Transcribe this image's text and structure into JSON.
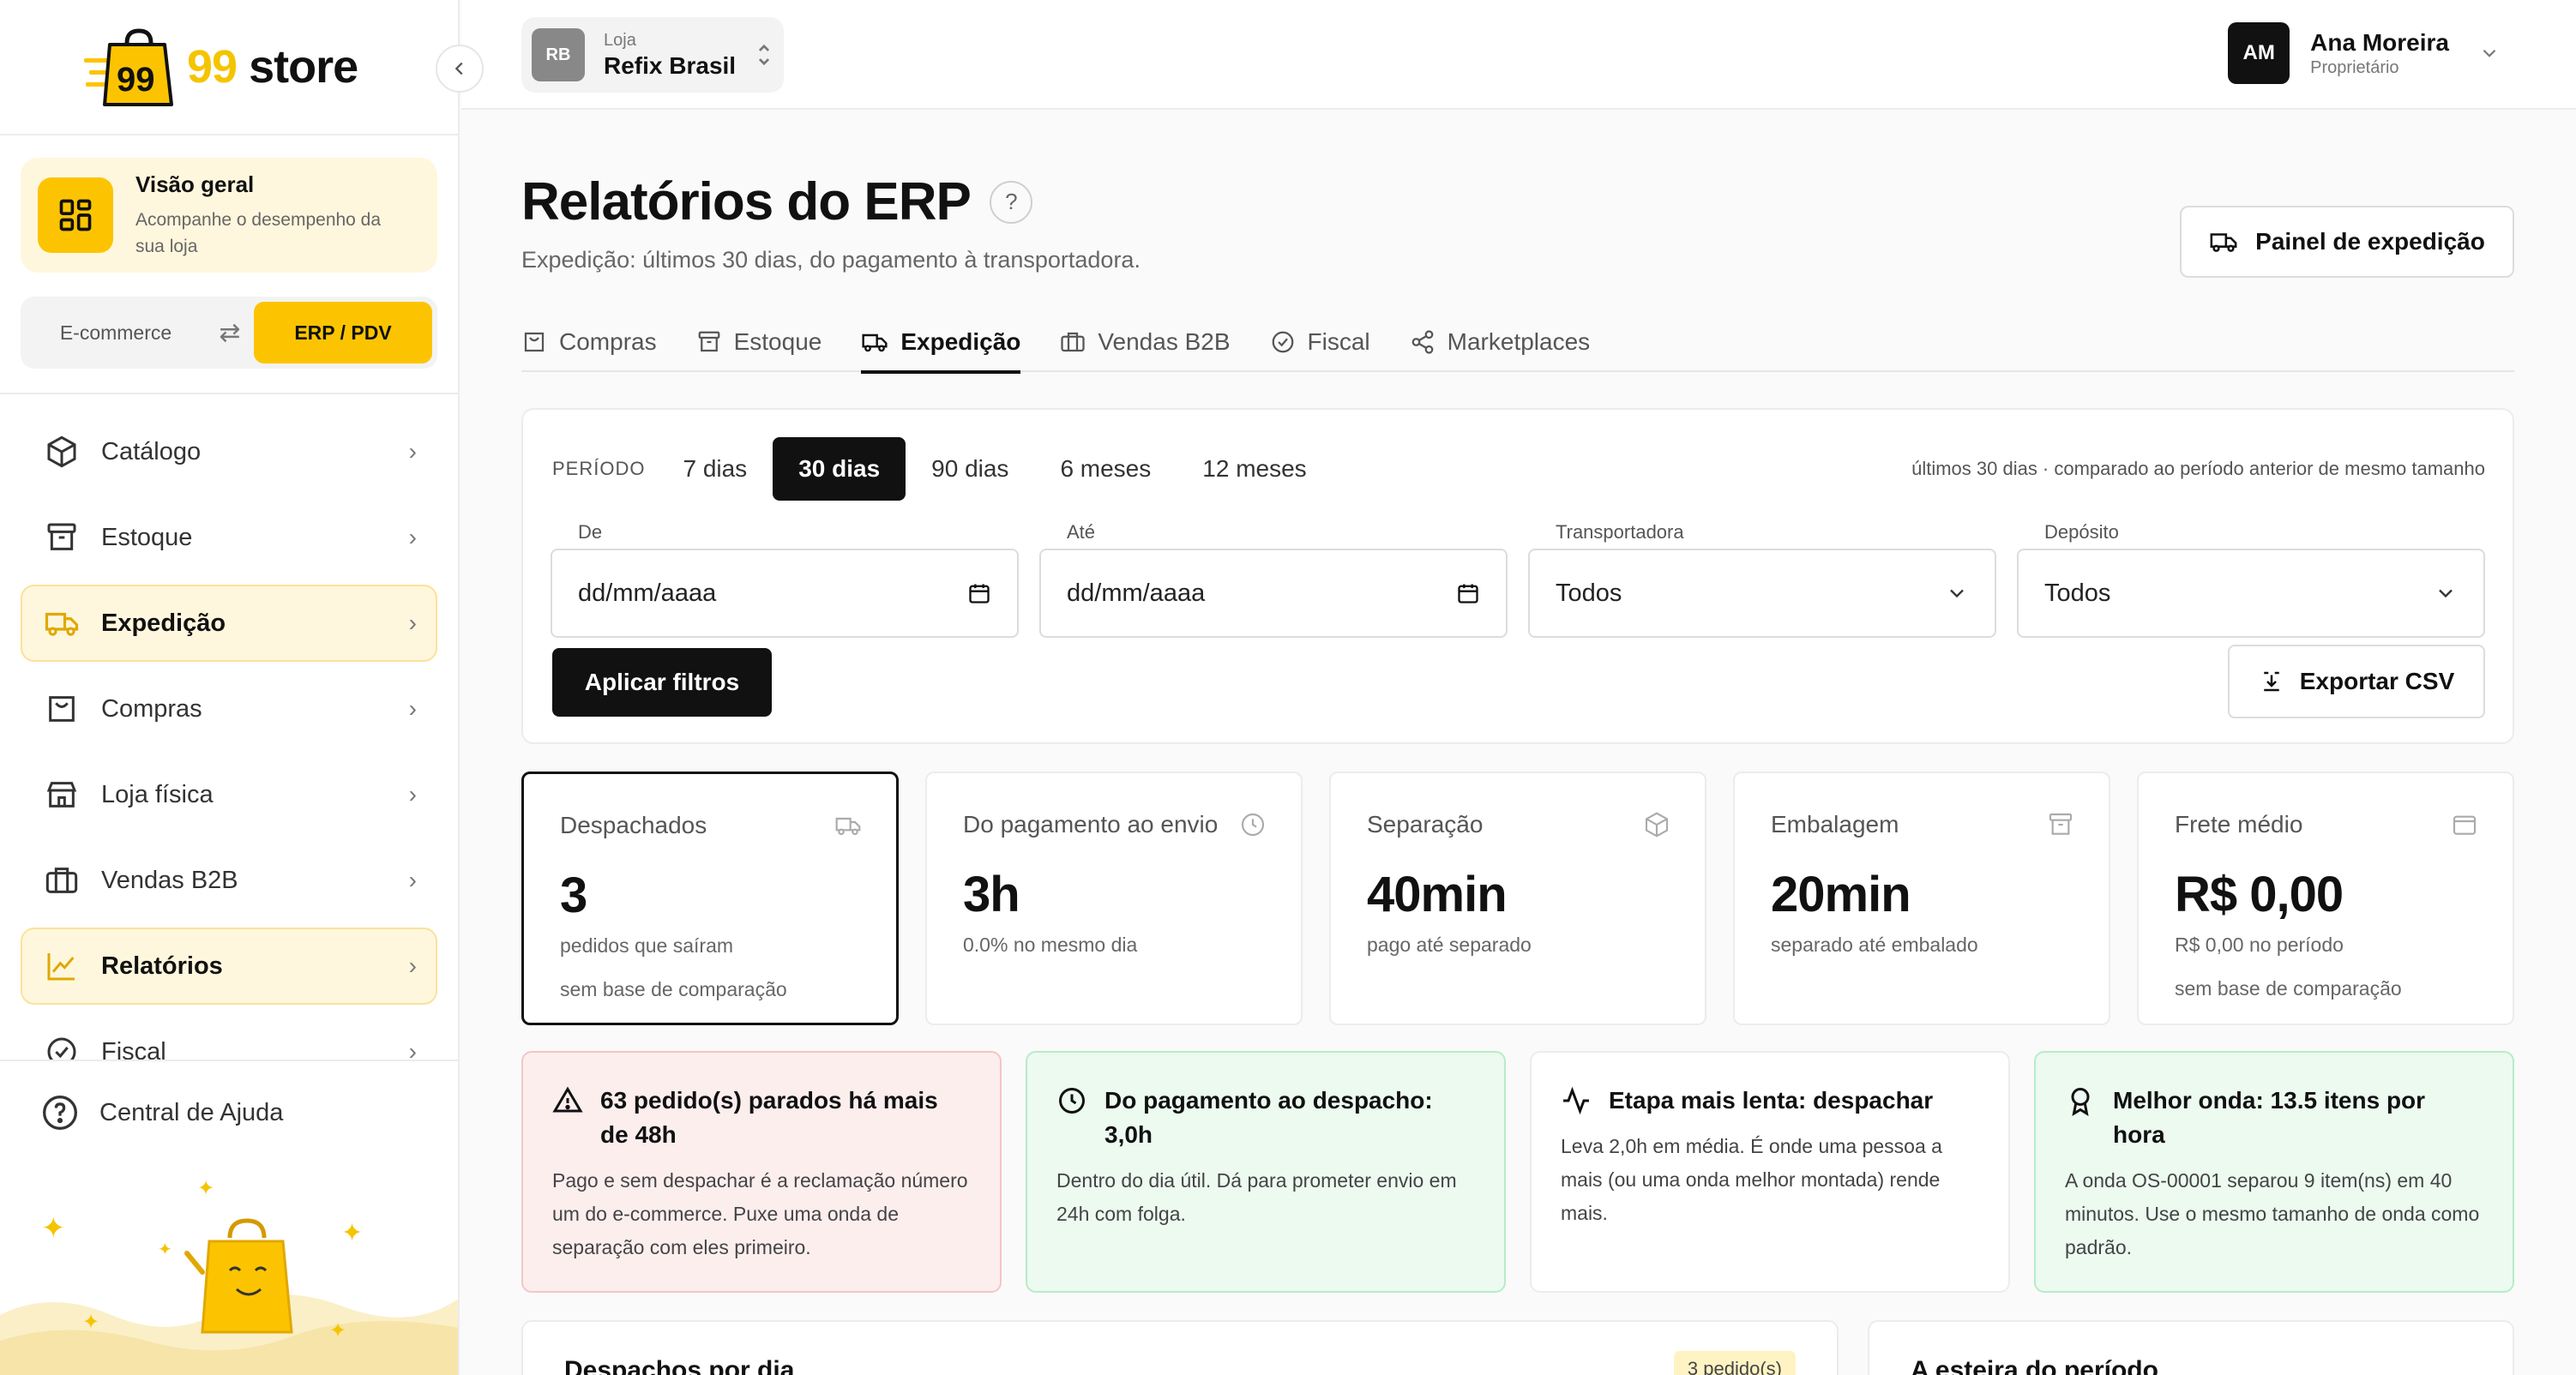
{
  "brand": {
    "logo_text": "99 store",
    "logo_badge": "99",
    "accent": "#fcc400"
  },
  "sidebar": {
    "overview": {
      "title": "Visão geral",
      "subtitle_line1": "Acompanhe o desempenho da",
      "subtitle_line2": "sua loja"
    },
    "switcher": {
      "left": "E-commerce",
      "right": "ERP / PDV",
      "active": "ERP / PDV"
    },
    "items": [
      {
        "label": "Catálogo",
        "icon": "box-icon",
        "active": false
      },
      {
        "label": "Estoque",
        "icon": "archive-icon",
        "active": false
      },
      {
        "label": "Expedição",
        "icon": "truck-icon",
        "active": true
      },
      {
        "label": "Compras",
        "icon": "shopping-bag-icon",
        "active": false
      },
      {
        "label": "Loja física",
        "icon": "store-icon",
        "active": false
      },
      {
        "label": "Vendas B2B",
        "icon": "briefcase-icon",
        "active": false
      },
      {
        "label": "Relatórios",
        "icon": "chart-line-icon",
        "active": true
      },
      {
        "label": "Fiscal",
        "icon": "check-circle-icon",
        "active": false
      }
    ],
    "help": "Central de Ajuda"
  },
  "topbar": {
    "store": {
      "initials": "RB",
      "caption": "Loja",
      "name": "Refix Brasil"
    },
    "user": {
      "initials": "AM",
      "name": "Ana Moreira",
      "role": "Proprietário"
    }
  },
  "page": {
    "title": "Relatórios do ERP",
    "subtitle": "Expedição: últimos 30 dias, do pagamento à transportadora.",
    "action_button": "Painel de expedição"
  },
  "tabs": [
    {
      "label": "Compras",
      "icon": "shopping-bag-icon",
      "active": false
    },
    {
      "label": "Estoque",
      "icon": "archive-icon",
      "active": false
    },
    {
      "label": "Expedição",
      "icon": "truck-icon",
      "active": true
    },
    {
      "label": "Vendas B2B",
      "icon": "briefcase-icon",
      "active": false
    },
    {
      "label": "Fiscal",
      "icon": "check-circle-icon",
      "active": false
    },
    {
      "label": "Marketplaces",
      "icon": "share-icon",
      "active": false
    }
  ],
  "filters": {
    "period_label": "PERÍODO",
    "periods": [
      "7 dias",
      "30 dias",
      "90 dias",
      "6 meses",
      "12 meses"
    ],
    "active_period": "30 dias",
    "note": "últimos 30 dias · comparado ao período anterior de mesmo tamanho",
    "from_label": "De",
    "from_value": "dd/mm/aaaa",
    "to_label": "Até",
    "to_value": "dd/mm/aaaa",
    "carrier_label": "Transportadora",
    "carrier_value": "Todos",
    "depot_label": "Depósito",
    "depot_value": "Todos",
    "apply": "Aplicar filtros",
    "export": "Exportar CSV"
  },
  "kpis": [
    {
      "title": "Despachados",
      "value": "3",
      "sub1": "pedidos que saíram",
      "sub2": "sem base de comparação",
      "icon": "truck-icon"
    },
    {
      "title": "Do pagamento ao envio",
      "value": "3h",
      "sub1": "0.0% no mesmo dia",
      "sub2": "",
      "icon": "clock-icon"
    },
    {
      "title": "Separação",
      "value": "40min",
      "sub1": "pago até separado",
      "sub2": "",
      "icon": "box-icon"
    },
    {
      "title": "Embalagem",
      "value": "20min",
      "sub1": "separado até embalado",
      "sub2": "",
      "icon": "archive-icon"
    },
    {
      "title": "Frete médio",
      "value": "R$ 0,00",
      "sub1": "R$ 0,00 no período",
      "sub2": "sem base de comparação",
      "icon": "wallet-icon"
    }
  ],
  "insights": [
    {
      "title": "63 pedido(s) parados há mais de 48h",
      "body": "Pago e sem despachar é a reclamação número um do e-commerce. Puxe uma onda de separação com eles primeiro.",
      "tone": "red",
      "icon": "warning-icon"
    },
    {
      "title": "Do pagamento ao despacho: 3,0h",
      "body": "Dentro do dia útil. Dá para prometer envio em 24h com folga.",
      "tone": "green",
      "icon": "clock-icon"
    },
    {
      "title": "Etapa mais lenta: despachar",
      "body": "Leva 2,0h em média. É onde uma pessoa a mais (ou uma onda melhor montada) rende mais.",
      "tone": "neutral",
      "icon": "activity-icon"
    },
    {
      "title": "Melhor onda: 13.5 itens por hora",
      "body": "A onda OS-00001 separou 9 item(ns) em 40 minutos. Use o mesmo tamanho de onda como padrão.",
      "tone": "green",
      "icon": "award-icon"
    }
  ],
  "bottom": {
    "left_title": "Despachos por dia",
    "left_badge": "3 pedido(s)",
    "right_title": "A esteira do período"
  }
}
